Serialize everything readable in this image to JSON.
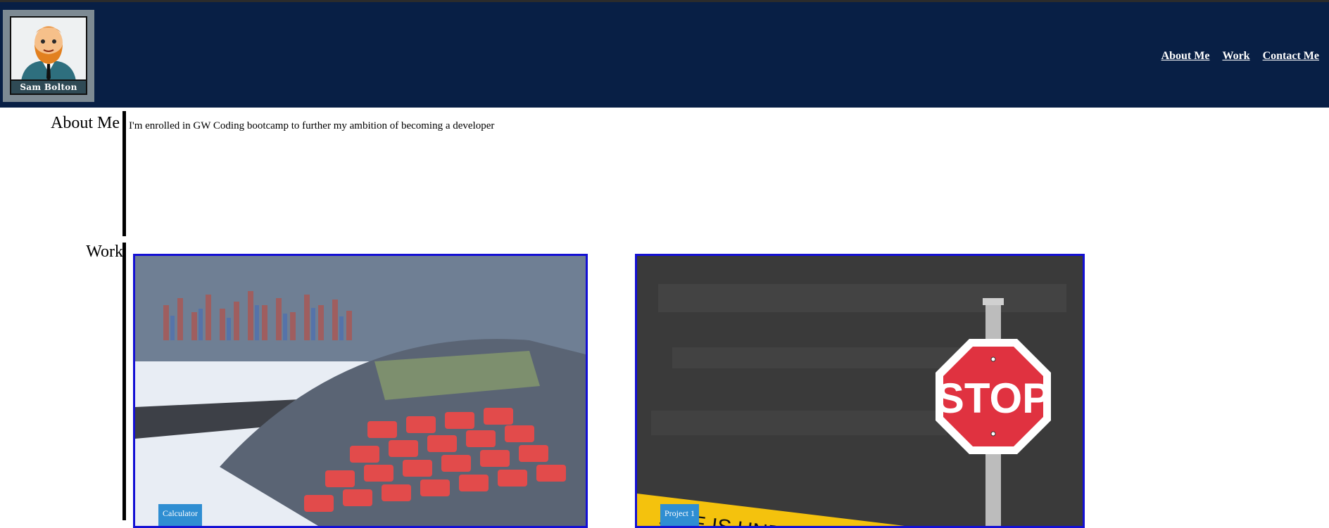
{
  "header": {
    "logo_name": "Sam Bolton",
    "nav": [
      "About Me",
      "Work",
      "Contact Me"
    ]
  },
  "about": {
    "title": "About Me",
    "text": "I'm enrolled in GW Coding bootcamp to further my ambition of becoming a developer"
  },
  "work": {
    "title": "Work",
    "projects": [
      {
        "label": "Calculator",
        "image": "calculator-image"
      },
      {
        "label": "Project 1",
        "image": "stop-sign-image",
        "sign_text": "STOP",
        "tape_text": "SITE IS UNDER"
      }
    ]
  },
  "colors": {
    "header_bg": "#081f45",
    "card_border": "#1410d4",
    "label_bg": "#2f8ed2"
  }
}
